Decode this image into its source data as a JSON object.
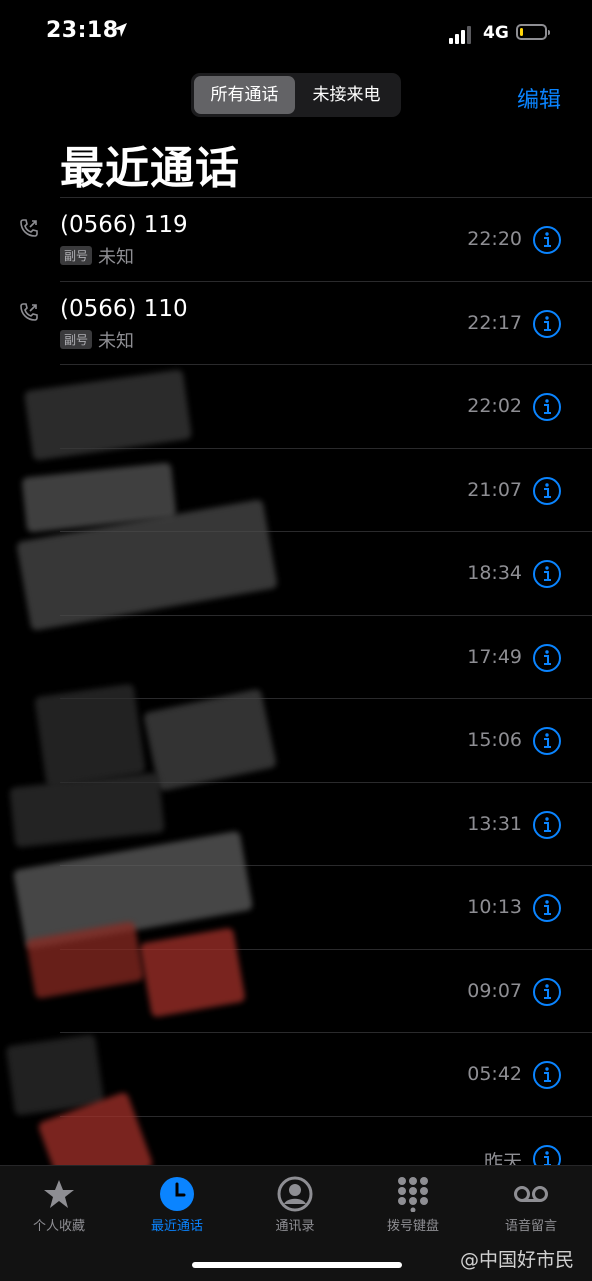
{
  "status_bar": {
    "time": "23:18",
    "network": "4G",
    "battery_level": 0.15
  },
  "header": {
    "segments": [
      {
        "label": "所有通话"
      },
      {
        "label": "未接来电"
      }
    ],
    "edit_label": "编辑",
    "title": "最近通话"
  },
  "calls": [
    {
      "title": "(0566) 119",
      "tag": "副号",
      "subtitle": "未知",
      "time": "22:20"
    },
    {
      "title": "(0566) 110",
      "tag": "副号",
      "subtitle": "未知",
      "time": "22:17"
    },
    {
      "title": "",
      "tag": "",
      "subtitle": "",
      "time": "22:02"
    },
    {
      "title": "",
      "tag": "",
      "subtitle": "",
      "time": "21:07"
    },
    {
      "title": "",
      "tag": "",
      "subtitle": "",
      "time": "18:34"
    },
    {
      "title": "",
      "tag": "",
      "subtitle": "",
      "time": "17:49"
    },
    {
      "title": "",
      "tag": "",
      "subtitle": "",
      "time": "15:06"
    },
    {
      "title": "",
      "tag": "",
      "subtitle": "",
      "time": "13:31"
    },
    {
      "title": "",
      "tag": "",
      "subtitle": "",
      "time": "10:13"
    },
    {
      "title": "",
      "tag": "",
      "subtitle": "",
      "time": "09:07"
    },
    {
      "title": "",
      "tag": "",
      "subtitle": "",
      "time": "05:42"
    },
    {
      "title": "",
      "tag": "",
      "subtitle": "",
      "time": "昨天"
    }
  ],
  "tabbar": {
    "tabs": [
      {
        "label": "个人收藏",
        "icon": "star-icon"
      },
      {
        "label": "最近通话",
        "icon": "clock-icon"
      },
      {
        "label": "通讯录",
        "icon": "contact-icon"
      },
      {
        "label": "拨号键盘",
        "icon": "keypad-icon"
      },
      {
        "label": "语音留言",
        "icon": "voicemail-icon"
      }
    ]
  },
  "watermark": "@中国好市民",
  "colors": {
    "accent": "#0a84ff",
    "background": "#000000",
    "secondary_text": "#8e8e93",
    "battery": "#ffd60a"
  }
}
